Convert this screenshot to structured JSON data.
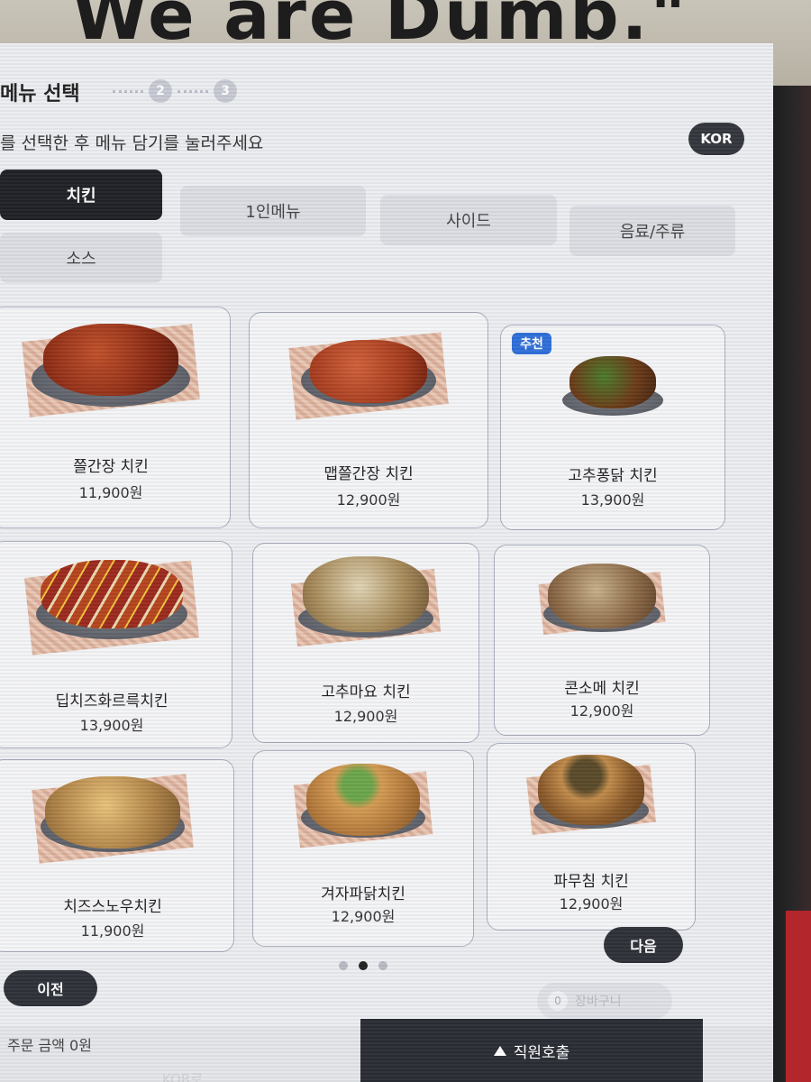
{
  "photo": {
    "marker_text": "We are Dumb.\""
  },
  "kiosk": {
    "step_title": "메뉴 선택",
    "steps": [
      "2",
      "3"
    ],
    "instruction": "를 선택한 후 메뉴 담기를 눌러주세요",
    "lang_button": "KOR",
    "tabs": [
      {
        "label": "치킨",
        "active": true
      },
      {
        "label": "1인메뉴",
        "active": false
      },
      {
        "label": "사이드",
        "active": false
      },
      {
        "label": "음료/주류",
        "active": false
      },
      {
        "label": "소스",
        "active": false
      }
    ],
    "menu_items": [
      {
        "name": "쯜간장 치킨",
        "price": "11,900원",
        "badge": "",
        "food_color": "#8a2a14"
      },
      {
        "name": "맵쯜간장 치킨",
        "price": "12,900원",
        "badge": "",
        "food_color": "#a33a1c"
      },
      {
        "name": "고추퐁닭 치킨",
        "price": "13,900원",
        "badge": "추천",
        "food_color": "#6b3a18"
      },
      {
        "name": "딥치즈화르륵치킨",
        "price": "13,900원",
        "badge": "",
        "food_color": "#9c2a1e"
      },
      {
        "name": "고추마요 치킨",
        "price": "12,900원",
        "badge": "",
        "food_color": "#a68a5a"
      },
      {
        "name": "콘소메 치킨",
        "price": "12,900원",
        "badge": "",
        "food_color": "#8c6a48"
      },
      {
        "name": "치즈스노우치킨",
        "price": "11,900원",
        "badge": "",
        "food_color": "#b08448"
      },
      {
        "name": "겨자파닭치킨",
        "price": "12,900원",
        "badge": "",
        "food_color": "#b47a3c"
      },
      {
        "name": "파무침 치킨",
        "price": "12,900원",
        "badge": "",
        "food_color": "#8a5a2a"
      }
    ],
    "next_button": "다음",
    "prev_button": "이전",
    "pager": {
      "current": 2,
      "total": 3
    },
    "cart": {
      "count": "0",
      "label": "장바구니"
    },
    "order_total": "주문 금액 0원",
    "staff_call": "직원호출",
    "bottom_cut_text": "KOR로"
  }
}
